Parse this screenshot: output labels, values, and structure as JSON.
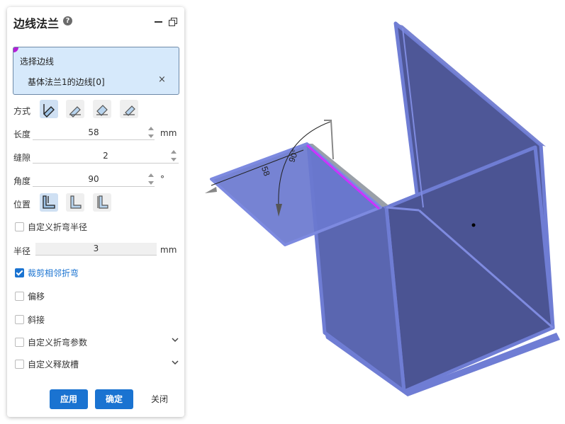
{
  "panel": {
    "title": "边线法兰",
    "help": "?",
    "selection": {
      "label": "选择边线",
      "item": "基体法兰1的边线[0]",
      "remove": "×"
    },
    "mode_label": "方式",
    "length": {
      "label": "长度",
      "value": "58",
      "unit": "mm"
    },
    "gap": {
      "label": "缝隙",
      "value": "2"
    },
    "angle": {
      "label": "角度",
      "value": "90",
      "unit": "°"
    },
    "position_label": "位置",
    "custom_bend_radius": {
      "label": "自定义折弯半径",
      "checked": false
    },
    "radius": {
      "label": "半径",
      "value": "3",
      "unit": "mm"
    },
    "trim_adjacent": {
      "label": "裁剪相邻折弯",
      "checked": true
    },
    "offset": {
      "label": "偏移",
      "checked": false
    },
    "miter": {
      "label": "斜接",
      "checked": false
    },
    "custom_bend_params": {
      "label": "自定义折弯参数",
      "checked": false
    },
    "custom_relief": {
      "label": "自定义释放槽",
      "checked": false
    },
    "buttons": {
      "apply": "应用",
      "ok": "确定",
      "close": "关闭"
    }
  },
  "viewport": {
    "dim_length": "58",
    "dim_angle": "90°"
  },
  "colors": {
    "accent": "#1a73d1",
    "part": "#5b67b3",
    "edge_highlight": "#cc33ff"
  }
}
